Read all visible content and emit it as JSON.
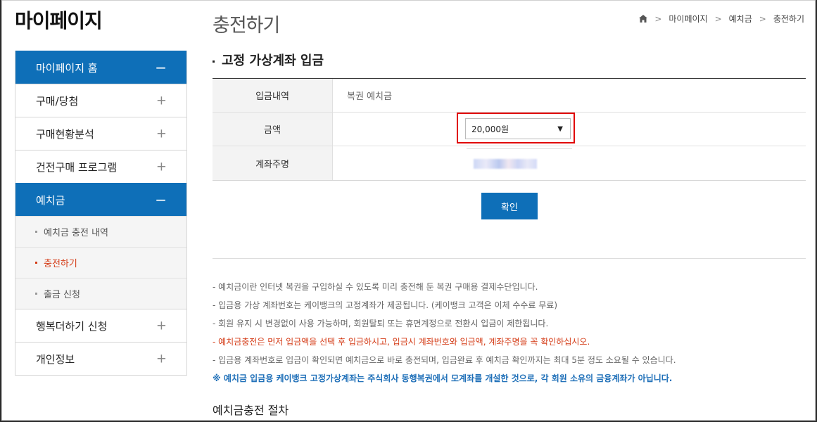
{
  "sidebar": {
    "title": "마이페이지",
    "items": [
      {
        "label": "마이페이지 홈",
        "toggle": "−"
      },
      {
        "label": "구매/당첨",
        "toggle": "+"
      },
      {
        "label": "구매현황분석",
        "toggle": "+"
      },
      {
        "label": "건전구매 프로그램",
        "toggle": "+"
      },
      {
        "label": "예치금",
        "toggle": "−"
      },
      {
        "label": "행복더하기 신청",
        "toggle": "+"
      },
      {
        "label": "개인정보",
        "toggle": "+"
      }
    ],
    "subitems": [
      {
        "label": "예치금 충전 내역"
      },
      {
        "label": "충전하기"
      },
      {
        "label": "출금 신청"
      }
    ]
  },
  "page": {
    "title": "충전하기",
    "breadcrumb": [
      "마이페이지",
      "예치금",
      "충전하기"
    ]
  },
  "section": {
    "title": "고정 가상계좌 입금"
  },
  "form": {
    "rows": [
      {
        "label": "입금내역",
        "value": "복권 예치금"
      },
      {
        "label": "금액",
        "value": "20,000원"
      },
      {
        "label": "계좌주명",
        "value": ""
      }
    ],
    "confirm_label": "확인"
  },
  "notes": [
    "-  예치금이란 인터넷 복권을 구입하실 수 있도록 미리 충전해 둔 복권 구매용 결제수단입니다.",
    "-  입금용 가상 계좌번호는 케이뱅크의 고정계좌가 제공됩니다. (케이뱅크 고객은 이체 수수료 무료)",
    "-  회원 유지 시 변경없이 사용 가능하며, 회원탈퇴 또는 휴면계정으로 전환시 입금이 제한됩니다.",
    "-  예치금충전은 먼저 입금액을 선택 후 입금하시고, 입금시 계좌번호와 입금액, 계좌주명을 꼭 확인하십시오.",
    "-  입금용 계좌번호로 입금이 확인되면 예치금으로 바로 충전되며, 입금완료 후 예치금 확인까지는 최대 5분 정도 소요될 수 있습니다.",
    "※ 예치금 입금용 케이뱅크 고정가상계좌는 주식회사 동행복권에서 모계좌를 개설한 것으로, 각 회원 소유의 금융계좌가 아닙니다."
  ],
  "procedure_title": "예치금충전 절차",
  "colors": {
    "accent": "#0e6fb8",
    "warning": "#d43b16",
    "highlight": "#e00000"
  }
}
